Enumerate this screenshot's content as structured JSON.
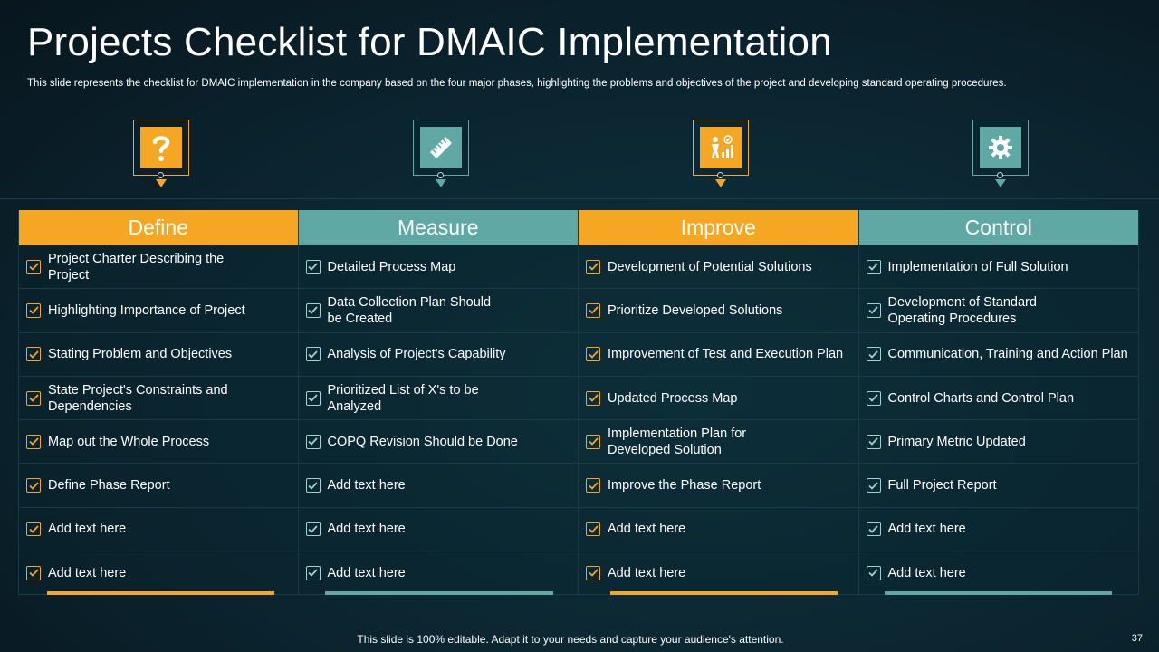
{
  "slide": {
    "title": "Projects Checklist for DMAIC Implementation",
    "subtitle": "This slide represents the checklist for DMAIC  implementation in the company based on the four major phases, highlighting the problems and objectives of the project and developing standard operating procedures.",
    "footer": "This slide is 100% editable. Adapt it to your needs and capture your audience's attention.",
    "page_number": "37"
  },
  "colors": {
    "orange": "#f5a623",
    "teal": "#5fa8a4",
    "background": "#0b2530"
  },
  "columns": [
    {
      "header": "Define",
      "accent": "orange",
      "icon": "question-mark-icon",
      "items": [
        "Project Charter Describing the Project",
        "Highlighting  Importance of Project",
        "Stating Problem and Objectives",
        "State Project's Constraints and Dependencies",
        "Map out the Whole Process",
        "Define Phase Report",
        "Add text here",
        "Add text here"
      ]
    },
    {
      "header": "Measure",
      "accent": "teal",
      "icon": "ruler-icon",
      "items": [
        "Detailed Process Map",
        "Data Collection Plan Should be Created",
        "Analysis of Project's Capability",
        "Prioritized List of X's to be Analyzed",
        "COPQ Revision Should be Done",
        "Add text here",
        "Add text here",
        "Add text here"
      ]
    },
    {
      "header": "Improve",
      "accent": "orange",
      "icon": "growth-chart-person-icon",
      "items": [
        "Development of Potential Solutions",
        "Prioritize Developed Solutions",
        "Improvement of Test and Execution Plan",
        "Updated Process Map",
        "Implementation Plan for Developed Solution",
        "Improve the Phase Report",
        "Add text here",
        "Add text here"
      ]
    },
    {
      "header": "Control",
      "accent": "teal",
      "icon": "gear-icon",
      "items": [
        "Implementation of Full Solution",
        "Development of Standard Operating Procedures",
        "Communication, Training and Action Plan",
        "Control Charts and Control Plan",
        "Primary Metric Updated",
        "Full Project Report",
        "Add text here",
        "Add text here"
      ]
    }
  ]
}
